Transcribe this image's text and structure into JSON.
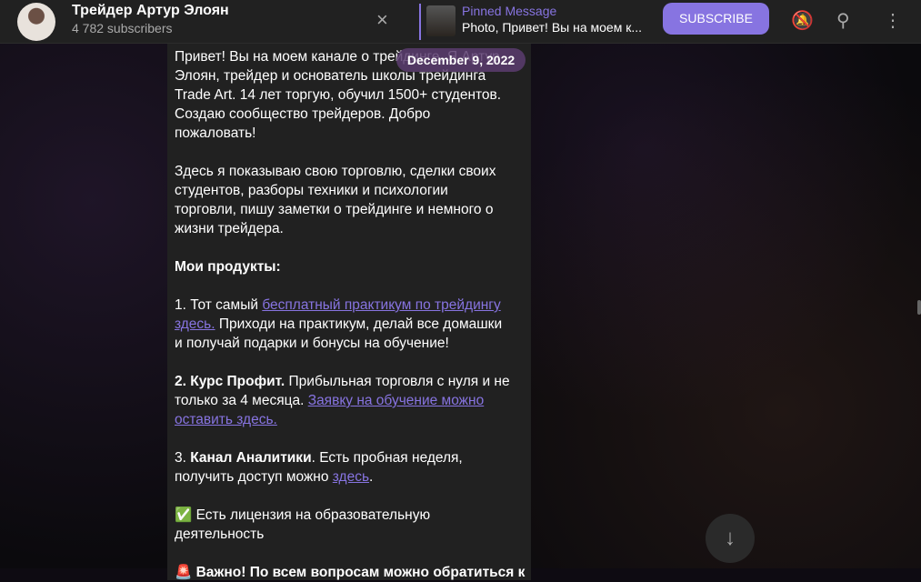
{
  "header": {
    "title": "Трейдер Артур Элоян",
    "subscribers": "4 782 subscribers",
    "close_icon": "×",
    "pinned_title": "Pinned Message",
    "pinned_text": "Photo, Привет! Вы на моем к...",
    "subscribe": "SUBSCRIBE",
    "mute_icon": "🔕",
    "search_icon": "⚲",
    "menu_icon": "⋮"
  },
  "date_badge": "December 9, 2022",
  "scroll_down_icon": "↓",
  "colors": {
    "accent": "#8774e1",
    "header_bg": "#212121",
    "bubble_bg": "#212121"
  },
  "message": {
    "lines": [
      [
        {
          "t": "Привет! Вы на моем канале о трейдинге. Я Артур"
        }
      ],
      [
        {
          "t": "Элоян, трейдер и основатель школы трейдинга"
        }
      ],
      [
        {
          "t": "Trade Art. 14 лет торгую, обучил 1500+ студентов."
        }
      ],
      [
        {
          "t": "Создаю сообщество трейдеров. Добро"
        }
      ],
      [
        {
          "t": "пожаловать!"
        }
      ],
      [],
      [
        {
          "t": "Здесь я показываю свою торговлю, сделки своих"
        }
      ],
      [
        {
          "t": "студентов, разборы техники и психологии"
        }
      ],
      [
        {
          "t": "торговли, пишу заметки о трейдинге и немного о"
        }
      ],
      [
        {
          "t": "жизни трейдера."
        }
      ],
      [],
      [
        {
          "t": "Мои продукты:",
          "s": "b"
        }
      ],
      [],
      [
        {
          "t": "1. Тот самый "
        },
        {
          "t": "бесплатный практикум по трейдингу",
          "s": "a"
        }
      ],
      [
        {
          "t": "здесь.",
          "s": "a"
        },
        {
          "t": " Приходи на практикум, делай все домашки"
        }
      ],
      [
        {
          "t": "и получай подарки и бонусы на обучение!"
        }
      ],
      [],
      [
        {
          "t": "2. Курс Профит.",
          "s": "b"
        },
        {
          "t": " Прибыльная торговля с нуля и не"
        }
      ],
      [
        {
          "t": "только за 4 месяца. "
        },
        {
          "t": "Заявку на обучение можно",
          "s": "a"
        }
      ],
      [
        {
          "t": "оставить здесь.",
          "s": "a"
        }
      ],
      [],
      [
        {
          "t": "3. "
        },
        {
          "t": "Канал Аналитики",
          "s": "b"
        },
        {
          "t": ". Есть пробная неделя,"
        }
      ],
      [
        {
          "t": "получить доступ можно "
        },
        {
          "t": "здесь",
          "s": "a"
        },
        {
          "t": "."
        }
      ],
      [],
      [
        {
          "t": "✅  Есть лицензия на образовательную"
        }
      ],
      [
        {
          "t": "деятельность"
        }
      ],
      [],
      [
        {
          "t": "🚨 Важно! По всем вопросам можно обратиться к",
          "s": "b"
        }
      ]
    ]
  }
}
